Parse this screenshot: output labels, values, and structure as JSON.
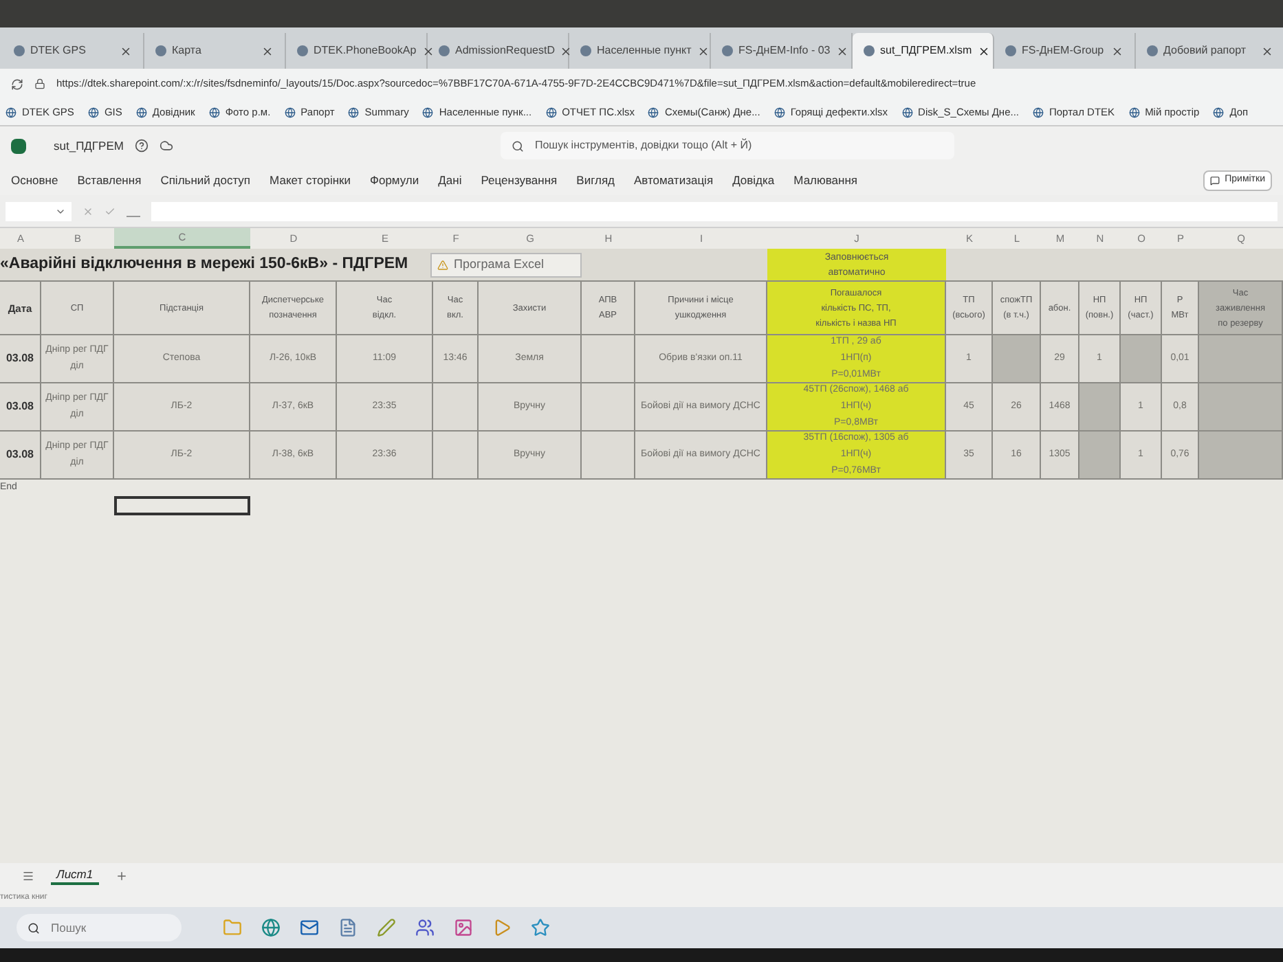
{
  "browser": {
    "tabs": [
      {
        "label": "DTEK GPS",
        "selected": false
      },
      {
        "label": "Карта",
        "selected": false
      },
      {
        "label": "DTEK.PhoneBookAp",
        "selected": false
      },
      {
        "label": "AdmissionRequestD",
        "selected": false
      },
      {
        "label": "Населенные пункт",
        "selected": false
      },
      {
        "label": "FS-ДнЕМ-Info - 03",
        "selected": false
      },
      {
        "label": "sut_ПДГРЕМ.xlsm",
        "selected": true
      },
      {
        "label": "FS-ДнЕМ-Group",
        "selected": false
      },
      {
        "label": "Добовий рапорт",
        "selected": false
      }
    ],
    "url": "https://dtek.sharepoint.com/:x:/r/sites/fsdneminfo/_layouts/15/Doc.aspx?sourcedoc=%7BBF17C70A-671A-4755-9F7D-2E4CCBC9D471%7D&file=sut_ПДГРЕМ.xlsm&action=default&mobileredirect=true",
    "bookmarks": [
      "DTEK GPS",
      "GIS",
      "Довідник",
      "Фото р.м.",
      "Рапорт",
      "Summary",
      "Населенные пунк...",
      "ОТЧЕТ ПС.xlsx",
      "Схемы(Санж) Дне...",
      "Горящі дефекти.xlsx",
      "Disk_S_Схемы Дне...",
      "Портал DTEK",
      "Мій простір",
      "Доп"
    ]
  },
  "excel": {
    "file_name": "sut_ПДГРЕМ",
    "search": {
      "placeholder": "Пошук інструментів, довідки тощо (Alt + Й)"
    },
    "ribbon_tabs": [
      "Основне",
      "Вставлення",
      "Спільний доступ",
      "Макет сторінки",
      "Формули",
      "Дані",
      "Рецензування",
      "Вигляд",
      "Автоматизація",
      "Довідка",
      "Малювання"
    ],
    "comments_button": "Примітки",
    "columns": [
      {
        "label": "A",
        "selected": false
      },
      {
        "label": "B",
        "selected": false
      },
      {
        "label": "C",
        "selected": true
      },
      {
        "label": "D",
        "selected": false
      },
      {
        "label": "E",
        "selected": false
      },
      {
        "label": "F",
        "selected": false
      },
      {
        "label": "G",
        "selected": false
      },
      {
        "label": "H",
        "selected": false
      },
      {
        "label": "I",
        "selected": false
      },
      {
        "label": "J",
        "selected": false
      },
      {
        "label": "K",
        "selected": false
      },
      {
        "label": "L",
        "selected": false
      },
      {
        "label": "M",
        "selected": false
      },
      {
        "label": "N",
        "selected": false
      },
      {
        "label": "O",
        "selected": false
      },
      {
        "label": "P",
        "selected": false
      },
      {
        "label": "Q",
        "selected": false
      }
    ],
    "sheet_title": "«Аварійні відключення в мережі 150-6кВ» - ПДГРЕМ",
    "notice": "Програма Excel",
    "auto_note": "Заповнюється\nавтоматично",
    "headers": [
      "Дата",
      "СП",
      "Підстанція",
      "Диспетчерське\nпозначення",
      "Час\nвідкл.",
      "Час\nвкл.",
      "Захисти",
      "АПВ\nАВР",
      "Причини і місце\nушкодження",
      "Погашалося\nкількість ПС, ТП,\nкількість і назва НП",
      "ТП\n(всього)",
      "спожТП\n(в т.ч.)",
      "абон.",
      "НП\n(повн.)",
      "НП\n(част.)",
      "Р\nМВт",
      "Час\nзаживлення\nпо резерву"
    ],
    "rows": [
      {
        "date": "03.08",
        "sp": "Дніпр рег ПДГ\nділ",
        "substation": "Степова",
        "designation": "Л-26, 10кВ",
        "time_off": "11:09",
        "time_on": "13:46",
        "protection": "Земля",
        "cause": "Обрив в'язки оп.11",
        "summary": "1ТП , 29 аб\n1НП(п)\nР=0,01МВт",
        "tp": "1",
        "abon": "29",
        "np_full": "1",
        "power": "0,01"
      },
      {
        "date": "03.08",
        "sp": "Дніпр рег ПДГ\nділ",
        "substation": "ЛБ-2",
        "designation": "Л-37, 6кВ",
        "time_off": "23:35",
        "protection": "Вручну",
        "cause": "Бойові дії на вимогу ДСНС",
        "summary": "45ТП (26спож), 1468 аб\n1НП(ч)\nР=0,8МВт",
        "tp": "45",
        "tp_consumer": "26",
        "abon": "1468",
        "np_part": "1",
        "power": "0,8"
      },
      {
        "date": "03.08",
        "sp": "Дніпр рег ПДГ\nділ",
        "substation": "ЛБ-2",
        "designation": "Л-38, 6кВ",
        "time_off": "23:36",
        "protection": "Вручну",
        "cause": "Бойові дії на вимогу ДСНС",
        "summary": "35ТП (16спож), 1305 аб\n1НП(ч)\nР=0,76МВт",
        "tp": "35",
        "tp_consumer": "16",
        "abon": "1305",
        "np_part": "1",
        "power": "0,76"
      }
    ],
    "end_label": "End",
    "sheets": [
      {
        "label": "Лист1",
        "selected": true
      }
    ],
    "status_text": "тистика книг"
  },
  "taskbar": {
    "search": {
      "placeholder": "Пошук"
    }
  }
}
